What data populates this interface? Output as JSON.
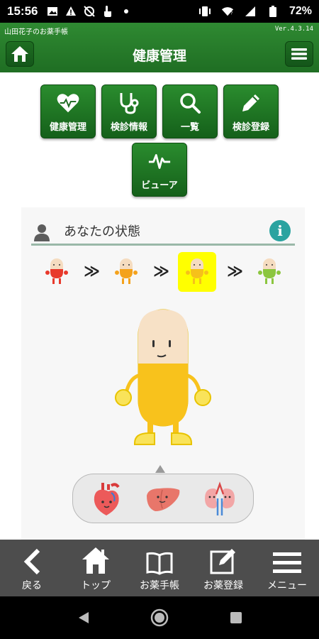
{
  "status_bar": {
    "time": "15:56",
    "battery": "72%",
    "icons": [
      "image-icon",
      "warning-icon",
      "no-sync-icon",
      "touch-icon",
      "dot-icon",
      "vibrate-icon",
      "wifi-icon",
      "signal-icon",
      "battery-icon"
    ]
  },
  "app": {
    "owner": "山田花子のお薬手帳",
    "version": "Ver.4.3.14",
    "title": "健康管理",
    "accent": "#1f6e23"
  },
  "grid_buttons": [
    {
      "label": "健康管理",
      "icon": "heart-pulse-icon"
    },
    {
      "label": "検診情報",
      "icon": "stethoscope-icon"
    },
    {
      "label": "一覧",
      "icon": "search-icon"
    },
    {
      "label": "検診登録",
      "icon": "pencil-icon"
    },
    {
      "label": "ビューア",
      "icon": "waveform-icon"
    }
  ],
  "panel": {
    "title": "あなたの状態",
    "stages": [
      {
        "name": "red",
        "color": "#e83a2c"
      },
      {
        "name": "orange",
        "color": "#f4a21c"
      },
      {
        "name": "yellow",
        "color": "#f6c11a"
      },
      {
        "name": "green",
        "color": "#8cc63f"
      }
    ],
    "arrow": "≫",
    "selected_stage": "yellow",
    "character_color": "#f6c11a",
    "organs": [
      "heart-icon",
      "liver-icon",
      "kidney-icon"
    ]
  },
  "bottom_nav": [
    {
      "label": "戻る",
      "icon": "back-chevron-icon"
    },
    {
      "label": "トップ",
      "icon": "house-icon"
    },
    {
      "label": "お薬手帳",
      "icon": "book-icon"
    },
    {
      "label": "お薬登録",
      "icon": "edit-icon"
    },
    {
      "label": "メニュー",
      "icon": "menu-lines-icon"
    }
  ]
}
